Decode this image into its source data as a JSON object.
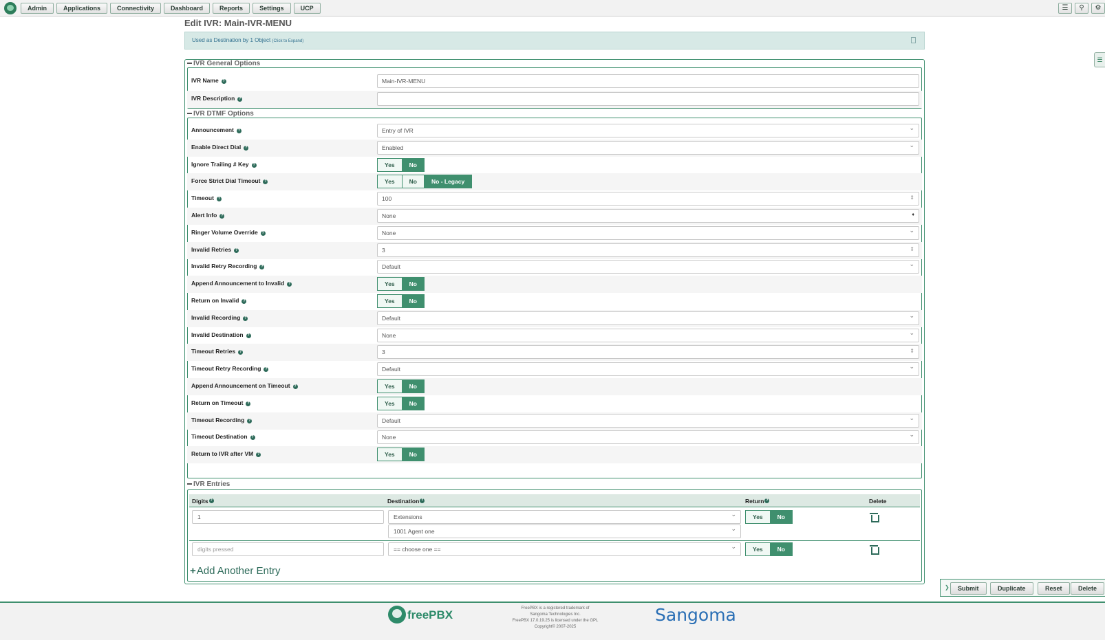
{
  "nav": {
    "items": [
      "Admin",
      "Applications",
      "Connectivity",
      "Dashboard",
      "Reports",
      "Settings",
      "UCP"
    ],
    "right_icons": [
      "language-icon",
      "search-icon",
      "gear-icon"
    ]
  },
  "page": {
    "title": "Edit IVR: Main-IVR-MENU",
    "info_text": "Used as Destination by 1 Object",
    "info_hint": "(Click to Expand)"
  },
  "general": {
    "heading": "IVR General Options",
    "rows": [
      {
        "label": "IVR Name",
        "value": "Main-IVR-MENU"
      },
      {
        "label": "IVR Description",
        "value": ""
      }
    ]
  },
  "dtmf": {
    "heading": "IVR DTMF Options",
    "rows": [
      {
        "label": "Announcement",
        "type": "select",
        "value": "Entry of IVR"
      },
      {
        "label": "Enable Direct Dial",
        "type": "select",
        "value": "Enabled"
      },
      {
        "label": "Ignore Trailing # Key",
        "type": "toggle",
        "options": [
          "Yes",
          "No"
        ],
        "selected": "No"
      },
      {
        "label": "Force Strict Dial Timeout",
        "type": "toggle",
        "options": [
          "Yes",
          "No",
          "No - Legacy"
        ],
        "selected": "No - Legacy"
      },
      {
        "label": "Timeout",
        "type": "number",
        "value": "100"
      },
      {
        "label": "Alert Info",
        "type": "select",
        "value": "None"
      },
      {
        "label": "Ringer Volume Override",
        "type": "select",
        "value": "None"
      },
      {
        "label": "Invalid Retries",
        "type": "number",
        "value": "3"
      },
      {
        "label": "Invalid Retry Recording",
        "type": "select",
        "value": "Default"
      },
      {
        "label": "Append Announcement to Invalid",
        "type": "toggle",
        "options": [
          "Yes",
          "No"
        ],
        "selected": "No"
      },
      {
        "label": "Return on Invalid",
        "type": "toggle",
        "options": [
          "Yes",
          "No"
        ],
        "selected": "No"
      },
      {
        "label": "Invalid Recording",
        "type": "select",
        "value": "Default"
      },
      {
        "label": "Invalid Destination",
        "type": "select",
        "value": "None"
      },
      {
        "label": "Timeout Retries",
        "type": "number",
        "value": "3"
      },
      {
        "label": "Timeout Retry Recording",
        "type": "select",
        "value": "Default"
      },
      {
        "label": "Append Announcement on Timeout",
        "type": "toggle",
        "options": [
          "Yes",
          "No"
        ],
        "selected": "No"
      },
      {
        "label": "Return on Timeout",
        "type": "toggle",
        "options": [
          "Yes",
          "No"
        ],
        "selected": "No"
      },
      {
        "label": "Timeout Recording",
        "type": "select",
        "value": "Default"
      },
      {
        "label": "Timeout Destination",
        "type": "select",
        "value": "None"
      },
      {
        "label": "Return to IVR after VM",
        "type": "toggle",
        "options": [
          "Yes",
          "No"
        ],
        "selected": "No"
      }
    ]
  },
  "entries": {
    "heading": "IVR Entries",
    "columns": [
      "Digits",
      "Destination",
      "Return",
      "Delete"
    ],
    "rows": [
      {
        "digits": "1",
        "digits_placeholder": "",
        "destination": "Extensions",
        "sub_destination": "1001 Agent one",
        "return_options": [
          "Yes",
          "No"
        ],
        "return_selected": "No"
      },
      {
        "digits": "",
        "digits_placeholder": "digits pressed",
        "destination": "== choose one ==",
        "sub_destination": null,
        "return_options": [
          "Yes",
          "No"
        ],
        "return_selected": "No"
      }
    ],
    "add_label": "Add Another Entry"
  },
  "actions": [
    "Submit",
    "Duplicate",
    "Reset",
    "Delete"
  ],
  "footer": {
    "brand": "freePBX",
    "legal": [
      "FreePBX is a registered trademark of",
      "Sangoma Technologies Inc.",
      "FreePBX 17.0.19.25 is licensed under the GPL",
      "Copyright© 2007-2025"
    ],
    "partner": "Sangoma"
  },
  "colors": {
    "accent": "#3f8f6e",
    "info_bg": "#d7e9e6",
    "link": "#2a6fb5"
  }
}
